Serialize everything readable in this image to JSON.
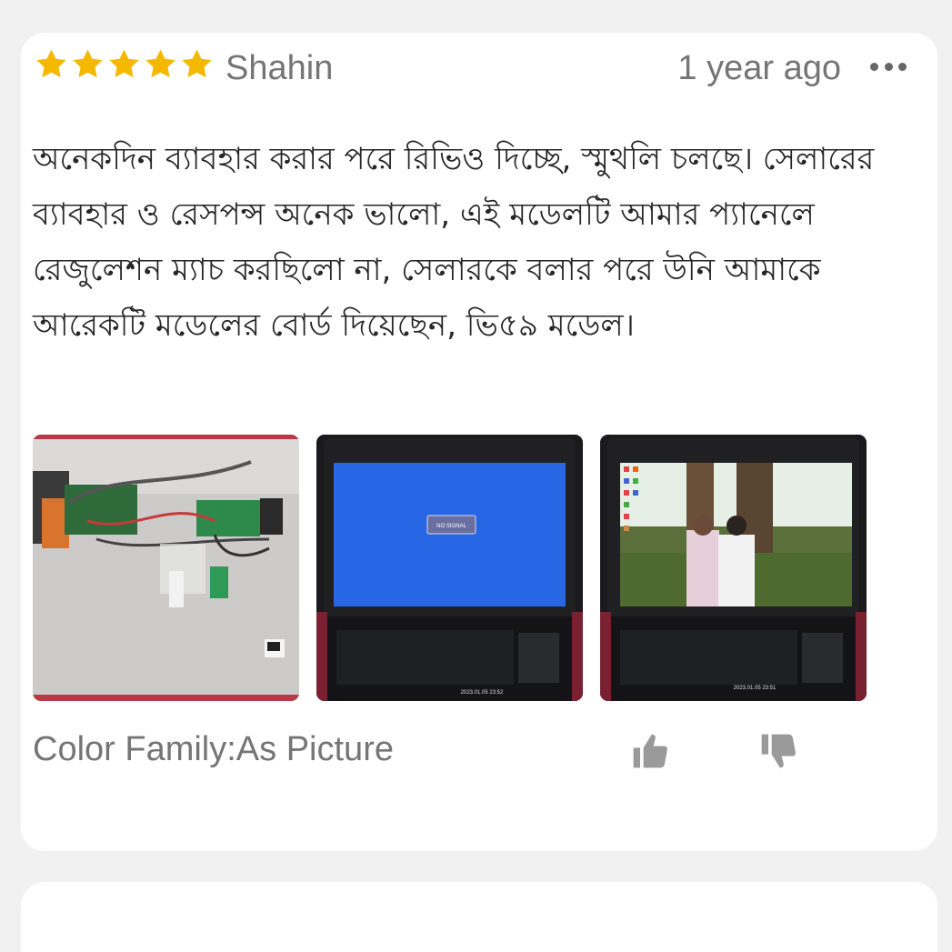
{
  "review": {
    "rating": 5,
    "rating_max": 5,
    "star_color": "#f5b800",
    "reviewer": "Shahin",
    "time": "1 year ago",
    "more_icon": "more-horizontal-icon",
    "text": "অনেকদিন ব্যাবহার করার পরে রিভিও দিচ্ছে, স্মুথলি চলছে। সেলারের ব্যাবহার ও রেসপন্স অনেক ভালো, এই মডেলটি আমার প্যানেলে রেজুলেশন ম্যাচ করছিলো না, সেলারকে বলার পরে উনি আমাকে আরেকটি মডেলের বোর্ড দিয়েছেন, ভি৫৯ মডেল।",
    "photos": [
      {
        "name": "controller-board-photo",
        "timestamp": ""
      },
      {
        "name": "laptop-no-signal-photo",
        "screen_text": "NO SIGNAL",
        "timestamp": "2023.01.05 23:52"
      },
      {
        "name": "laptop-desktop-photo",
        "timestamp": "2023.01.05 23:51"
      }
    ],
    "variant": "Color Family:As Picture",
    "like_icon": "thumbs-up-icon",
    "dislike_icon": "thumbs-down-icon"
  }
}
